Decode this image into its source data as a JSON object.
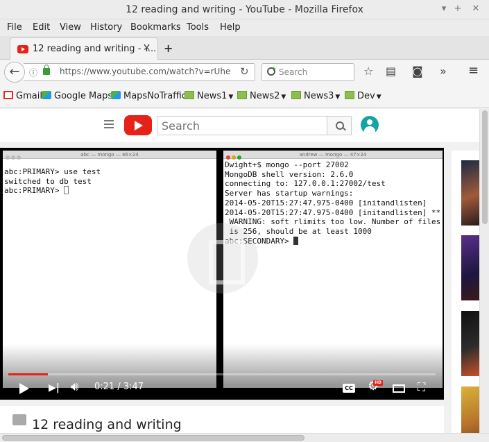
{
  "window": {
    "title": "12 reading and writing - YouTube - Mozilla Firefox"
  },
  "menu": [
    "File",
    "Edit",
    "View",
    "History",
    "Bookmarks",
    "Tools",
    "Help"
  ],
  "tab": {
    "label": "12 reading and writing - Y..."
  },
  "nav": {
    "url": "https://www.youtube.com/watch?v=rUhe",
    "search_placeholder": "Search"
  },
  "bookmarks": [
    "Gmail",
    "Google Maps",
    "MapsNoTraffic",
    "News1",
    "News2",
    "News3",
    "Dev"
  ],
  "youtube": {
    "search_placeholder": "Search"
  },
  "video": {
    "left_terminal_title": "abc — mongo — 46×24",
    "right_terminal_title": "andrew — mongo — 47×24",
    "left_lines": [
      "abc:PRIMARY> use test",
      "switched to db test",
      "abc:PRIMARY> "
    ],
    "right_lines": [
      "Dwight+$ mongo --port 27002",
      "MongoDB shell version: 2.6.0",
      "connecting to: 127.0.0.1:27002/test",
      "Server has startup warnings:",
      "2014-05-20T15:27:47.975-0400 [initandlisten]",
      "2014-05-20T15:27:47.975-0400 [initandlisten] **",
      " WARNING: soft rlimits too low. Number of files",
      " is 256, should be at least 1000",
      "abc:SECONDARY> "
    ],
    "time": "0:21 / 3:47",
    "progress_fraction": 0.0925,
    "cc_label": "CC",
    "hd_label": "HD",
    "title": "12 reading and writing"
  }
}
